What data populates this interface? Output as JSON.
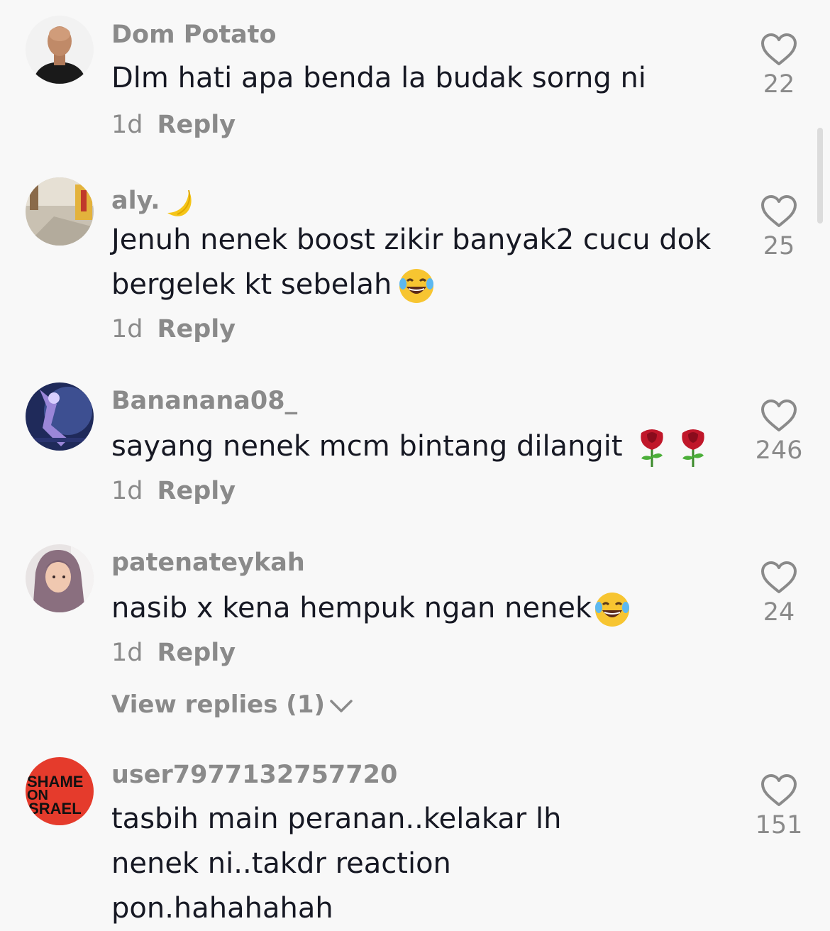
{
  "comments": [
    {
      "username": "Dom Potato",
      "text": "Dlm hati apa benda la budak sorng ni",
      "time": "1d",
      "reply_label": "Reply",
      "likes": "22",
      "avatar": "bald-man-avatar"
    },
    {
      "username": "aly.",
      "username_emoji": "crescent-moon",
      "text": "Jenuh nenek boost zikir banyak2 cucu dok bergelek kt sebelah",
      "text_emoji": "laughing-tears",
      "time": "1d",
      "reply_label": "Reply",
      "likes": "25",
      "avatar": "room-photo-avatar"
    },
    {
      "username": "Bananana08_",
      "text": "sayang nenek mcm bintang dilangit",
      "text_emoji": "rose rose",
      "time": "1d",
      "reply_label": "Reply",
      "likes": "246",
      "avatar": "game-character-avatar"
    },
    {
      "username": "patenateykah",
      "text": "nasib x kena hempuk ngan nenek",
      "text_emoji": "laughing-tears",
      "time": "1d",
      "reply_label": "Reply",
      "likes": "24",
      "avatar": "hijab-woman-avatar",
      "view_replies": "View replies (1)"
    },
    {
      "username": "user7977132757720",
      "text": "tasbih main peranan..kelakar lh nenek ni..takdr reaction pon.hahahahah",
      "likes": "151",
      "avatar": "shame-on-israel-avatar",
      "avatar_text": [
        "SHAME",
        "ON",
        "ISRAEL"
      ]
    }
  ],
  "colors": {
    "background": "#f8f8f8",
    "username": "#8a8a8a",
    "text": "#161823",
    "meta": "#8a8a8a"
  },
  "icons": {
    "like": "heart-outline-icon",
    "expand": "chevron-down-icon"
  }
}
